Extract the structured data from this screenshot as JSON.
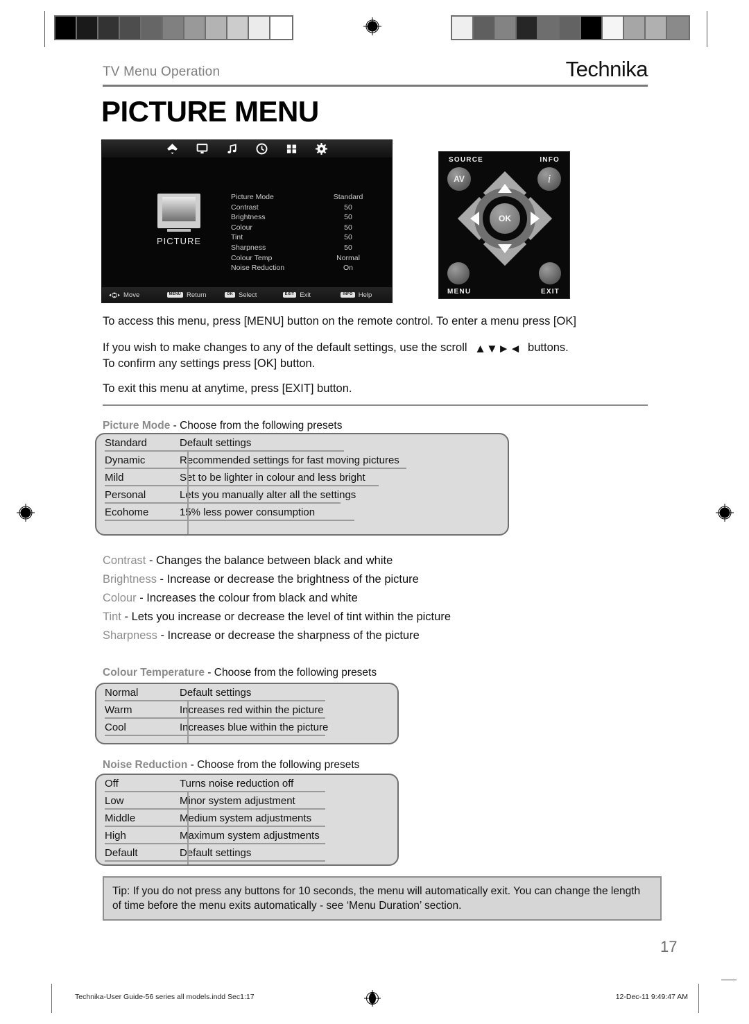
{
  "header": {
    "section_title": "TV Menu Operation",
    "brand": "Technika",
    "page_title": "PICTURE MENU"
  },
  "osd": {
    "menu_icons": [
      "picture-icon",
      "screen-icon",
      "sound-icon",
      "time-icon",
      "option-icon",
      "setup-icon"
    ],
    "panel_label": "PICTURE",
    "settings": [
      {
        "label": "Picture Mode",
        "value": "Standard"
      },
      {
        "label": "Contrast",
        "value": "50"
      },
      {
        "label": "Brightness",
        "value": "50"
      },
      {
        "label": "Colour",
        "value": "50"
      },
      {
        "label": "Tint",
        "value": "50"
      },
      {
        "label": "Sharpness",
        "value": "50"
      },
      {
        "label": "Colour Temp",
        "value": "Normal"
      },
      {
        "label": "Noise Reduction",
        "value": "On"
      }
    ],
    "statusbar": [
      {
        "key": "",
        "label": "Move"
      },
      {
        "key": "MENU",
        "label": "Return"
      },
      {
        "key": "OK",
        "label": "Select"
      },
      {
        "key": "EXIT",
        "label": "Exit"
      },
      {
        "key": "INFO",
        "label": "Help"
      }
    ]
  },
  "remote": {
    "source_label": "SOURCE",
    "info_label": "INFO",
    "menu_label": "MENU",
    "exit_label": "EXIT",
    "av_button": "AV",
    "info_button": "i",
    "ok_button": "OK"
  },
  "intro": {
    "line1": "To access this menu, press [MENU] button on the remote control. To enter a menu press [OK]",
    "line2_a": "If you wish to make changes to any of the default settings, use the scroll",
    "line2_b": "buttons.",
    "line3": "To confirm any settings press [OK] button.",
    "line4": "To exit this menu at anytime, press [EXIT] button.",
    "scroll_arrows": [
      "▲",
      "▼",
      "►",
      "◄"
    ]
  },
  "picture_mode": {
    "term": "Picture Mode",
    "heading_rest": " - Choose from the following presets",
    "rows": [
      {
        "name": "Standard",
        "desc": "Default settings"
      },
      {
        "name": "Dynamic",
        "desc": "Recommended settings for fast moving pictures"
      },
      {
        "name": "Mild",
        "desc": "Set to be lighter in colour and less bright"
      },
      {
        "name": "Personal",
        "desc": "Lets you manually alter all the settings"
      },
      {
        "name": "Ecohome",
        "desc": "15% less power consumption"
      }
    ]
  },
  "terms": [
    {
      "term": "Contrast",
      "desc": " - Changes the balance between black and white"
    },
    {
      "term": "Brightness",
      "desc": " - Increase or decrease the brightness of the picture"
    },
    {
      "term": "Colour",
      "desc": " - Increases the colour from black and white"
    },
    {
      "term": "Tint",
      "desc": " - Lets you increase or decrease the level of tint within the picture"
    },
    {
      "term": "Sharpness",
      "desc": " - Increase or decrease the sharpness of the picture"
    }
  ],
  "colour_temperature": {
    "term": "Colour Temperature",
    "heading_rest": " - Choose from the following presets",
    "rows": [
      {
        "name": "Normal",
        "desc": "Default settings"
      },
      {
        "name": "Warm",
        "desc": "Increases red within the picture"
      },
      {
        "name": "Cool",
        "desc": "Increases blue within the picture"
      }
    ]
  },
  "noise_reduction": {
    "term": "Noise Reduction",
    "heading_rest": " - Choose from the following presets",
    "rows": [
      {
        "name": "Off",
        "desc": "Turns noise reduction off"
      },
      {
        "name": "Low",
        "desc": "Minor system adjustment"
      },
      {
        "name": "Middle",
        "desc": "Medium system adjustments"
      },
      {
        "name": "High",
        "desc": "Maximum system adjustments"
      },
      {
        "name": "Default",
        "desc": "Default settings"
      }
    ]
  },
  "tip": {
    "text": "Tip: If you do not press any buttons for 10 seconds, the menu will automatically exit. You can change the length of time before the menu exits automatically - see ‘Menu Duration’ section."
  },
  "page_number": "17",
  "footer": {
    "left": "Technika-User Guide-56 series all models.indd   Sec1:17",
    "right": "12-Dec-11   9:49:47 AM"
  },
  "print_marks": {
    "left_wedge": [
      "#000000",
      "#1a1a1a",
      "#333333",
      "#4d4d4d",
      "#666666",
      "#808080",
      "#999999",
      "#b3b3b3",
      "#cccccc",
      "#ebebeb",
      "#ffffff"
    ],
    "right_wedge": [
      "#efefef",
      "#5f5f5f",
      "#838383",
      "#262626",
      "#6e6e6e",
      "#636363",
      "#000000",
      "#f5f5f5",
      "#a6a6a6",
      "#b0b0b0",
      "#8a8a8a"
    ]
  }
}
